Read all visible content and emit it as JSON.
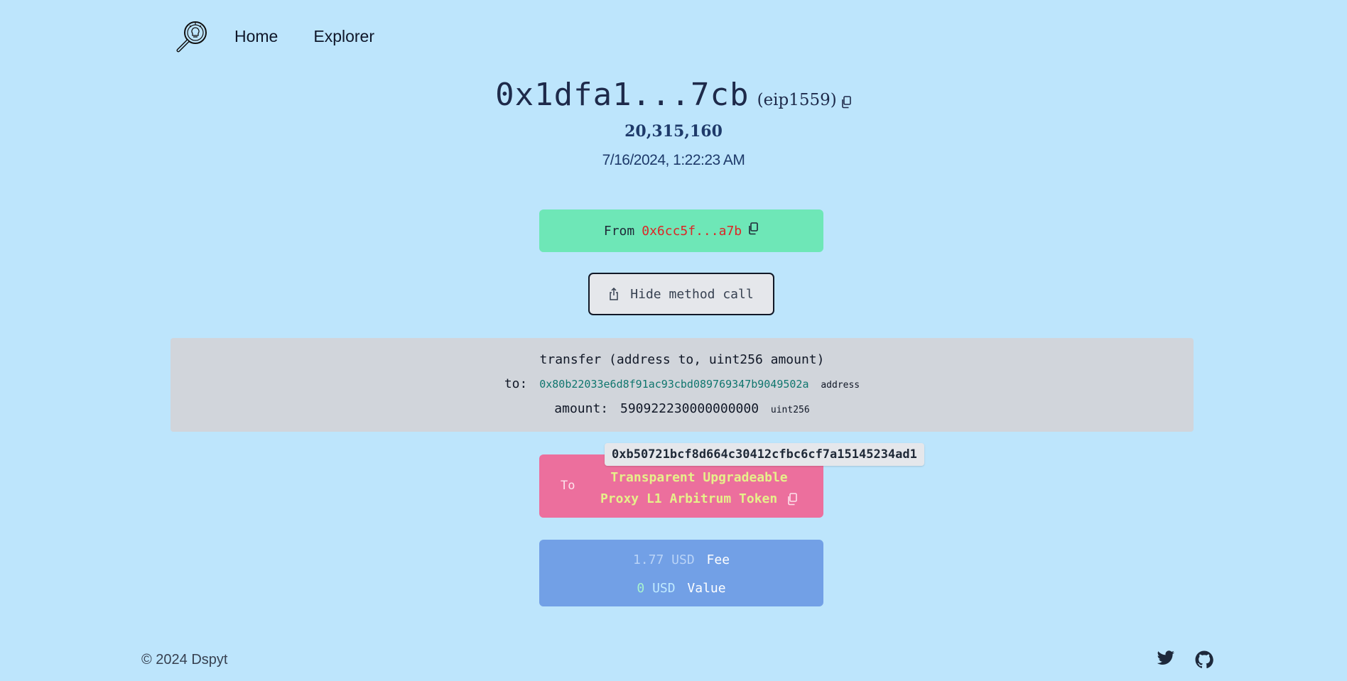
{
  "nav": {
    "home": "Home",
    "explorer": "Explorer"
  },
  "tx": {
    "hash": "0x1dfa1...7cb",
    "type": "(eip1559)",
    "block": "20,315,160",
    "timestamp": "7/16/2024, 1:22:23 AM"
  },
  "from": {
    "label": "From",
    "address": "0x6cc5f...a7b"
  },
  "method_toggle": {
    "label": "Hide method call"
  },
  "method": {
    "signature": "transfer (address to, uint256 amount)",
    "args": [
      {
        "name": "to:",
        "value": "0x80b22033e6d8f91ac93cbd089769347b9049502a",
        "type": "address"
      },
      {
        "name": "amount:",
        "value": "590922230000000000",
        "type": "uint256"
      }
    ]
  },
  "to": {
    "label": "To",
    "name_line1": "Transparent Upgradeable",
    "name_line2": "Proxy L1 Arbitrum Token",
    "tooltip_address": "0xb50721bcf8d664c30412cfbc6cf7a15145234ad1"
  },
  "fee": {
    "amount": "1.77",
    "currency": "USD",
    "label": "Fee"
  },
  "value": {
    "amount": "0",
    "currency": "USD",
    "label": "Value"
  },
  "footer": {
    "copyright": "© 2024 Dspyt"
  },
  "icons": [
    "magnifier-logo-icon",
    "copy-icon",
    "share-icon",
    "twitter-icon",
    "github-icon"
  ]
}
